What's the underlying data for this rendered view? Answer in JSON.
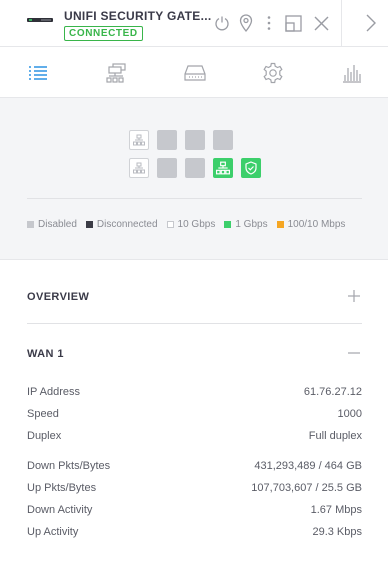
{
  "header": {
    "title": "UNIFI SECURITY GATE...",
    "status": "CONNECTED",
    "icons": [
      "device-thumb-icon",
      "restart-icon",
      "locate-icon",
      "more-icon",
      "popout-icon",
      "close-icon",
      "next-icon"
    ]
  },
  "tabs": [
    {
      "name": "details",
      "icon": "list-icon",
      "active": true
    },
    {
      "name": "network",
      "icon": "topology-icon",
      "active": false
    },
    {
      "name": "device",
      "icon": "hardware-icon",
      "active": false
    },
    {
      "name": "settings",
      "icon": "gear-icon",
      "active": false
    },
    {
      "name": "statistics",
      "icon": "stats-icon",
      "active": false
    }
  ],
  "ports": {
    "legend": [
      {
        "label": "Disabled",
        "color": "#c6c8cd"
      },
      {
        "label": "Disconnected",
        "color": "#3b3c46"
      },
      {
        "label": "10 Gbps",
        "color": "#ffffff"
      },
      {
        "label": "1 Gbps",
        "color": "#3ccf6b"
      },
      {
        "label": "100/10 Mbps",
        "color": "#f5a623"
      }
    ]
  },
  "overview": {
    "title": "OVERVIEW"
  },
  "wan": {
    "title": "WAN 1",
    "details": [
      {
        "label": "IP Address",
        "value": "61.76.27.12"
      },
      {
        "label": "Speed",
        "value": "1000"
      },
      {
        "label": "Duplex",
        "value": "Full duplex"
      }
    ],
    "stats": [
      {
        "label": "Down Pkts/Bytes",
        "value": "431,293,489 / 464 GB"
      },
      {
        "label": "Up Pkts/Bytes",
        "value": "107,703,607 / 25.5 GB"
      },
      {
        "label": "Down Activity",
        "value": "1.67 Mbps"
      },
      {
        "label": "Up Activity",
        "value": "29.3 Kbps"
      }
    ]
  },
  "colors": {
    "accent": "#1d8ce0",
    "connected": "#39b54a",
    "port_1g": "#3ccf6b",
    "port_disabled": "#c6c8cd"
  }
}
